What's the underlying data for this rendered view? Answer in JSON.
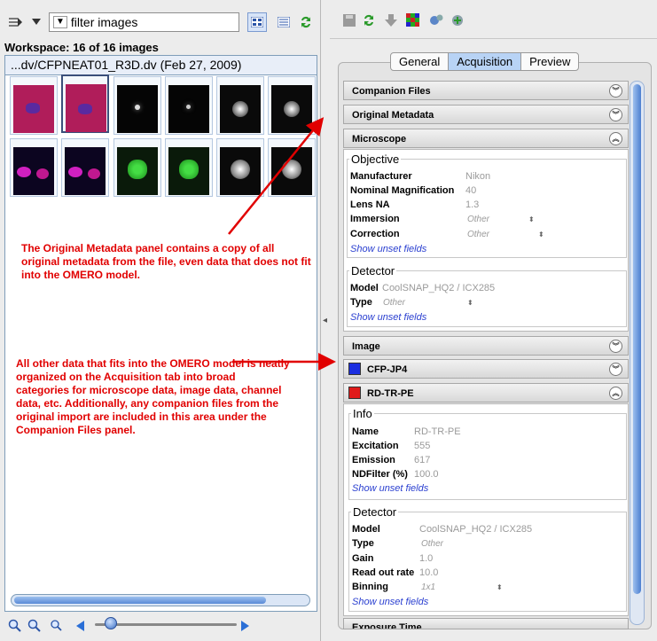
{
  "left": {
    "filter_text": "filter  images",
    "workspace": "Workspace: 16 of 16 images",
    "browser_title": "...dv/CFPNEAT01_R3D.dv (Feb 27, 2009)"
  },
  "tabs": [
    "General",
    "Acquisition",
    "Preview"
  ],
  "sections": {
    "companion": "Companion Files",
    "original": "Original Metadata",
    "microscope": "Microscope",
    "image": "Image",
    "ch1": "CFP-JP4",
    "ch2": "RD-TR-PE",
    "exposure": "Exposure Time"
  },
  "objective": {
    "title": "Objective",
    "rows": [
      {
        "label": "Manufacturer",
        "value": "Nikon"
      },
      {
        "label": "Nominal Magnification",
        "value": "40"
      },
      {
        "label": "Lens NA",
        "value": "1.3"
      },
      {
        "label": "Immersion",
        "value": "Other"
      },
      {
        "label": "Correction",
        "value": "Other"
      }
    ],
    "link": "Show unset fields"
  },
  "detector1": {
    "title": "Detector",
    "model_label": "Model",
    "model_value": "CoolSNAP_HQ2 / ICX285",
    "type_label": "Type",
    "type_value": "Other",
    "link": "Show unset fields"
  },
  "info": {
    "title": "Info",
    "rows": [
      {
        "label": "Name",
        "value": "RD-TR-PE"
      },
      {
        "label": "Excitation",
        "value": "555"
      },
      {
        "label": "Emission",
        "value": "617"
      },
      {
        "label": "NDFilter (%)",
        "value": "100.0"
      }
    ],
    "link": "Show unset fields"
  },
  "detector2": {
    "title": "Detector",
    "rows": [
      {
        "label": "Model",
        "value": "CoolSNAP_HQ2 / ICX285"
      },
      {
        "label": "Type",
        "value": "Other"
      },
      {
        "label": "Gain",
        "value": "1.0"
      },
      {
        "label": "Read out rate",
        "value": "10.0"
      },
      {
        "label": "Binning",
        "value": "1x1"
      }
    ],
    "link": "Show unset fields"
  },
  "annotations": {
    "note1": "The Original Metadata panel contains a copy of all original metadata from the file, even data that does not fit into the OMERO model.",
    "note2": "All other data that fits into the OMERO model is neatly organized on the Acquisition tab into broad categories for microscope data, image data, channel data, etc. Additionally, any companion files from the original import are included in this area under the Companion Files panel."
  },
  "colors": {
    "ch1": "#1b2ee0",
    "ch2": "#e01b1b",
    "annotation": "#e10000",
    "accent": "#b8d3f5"
  }
}
